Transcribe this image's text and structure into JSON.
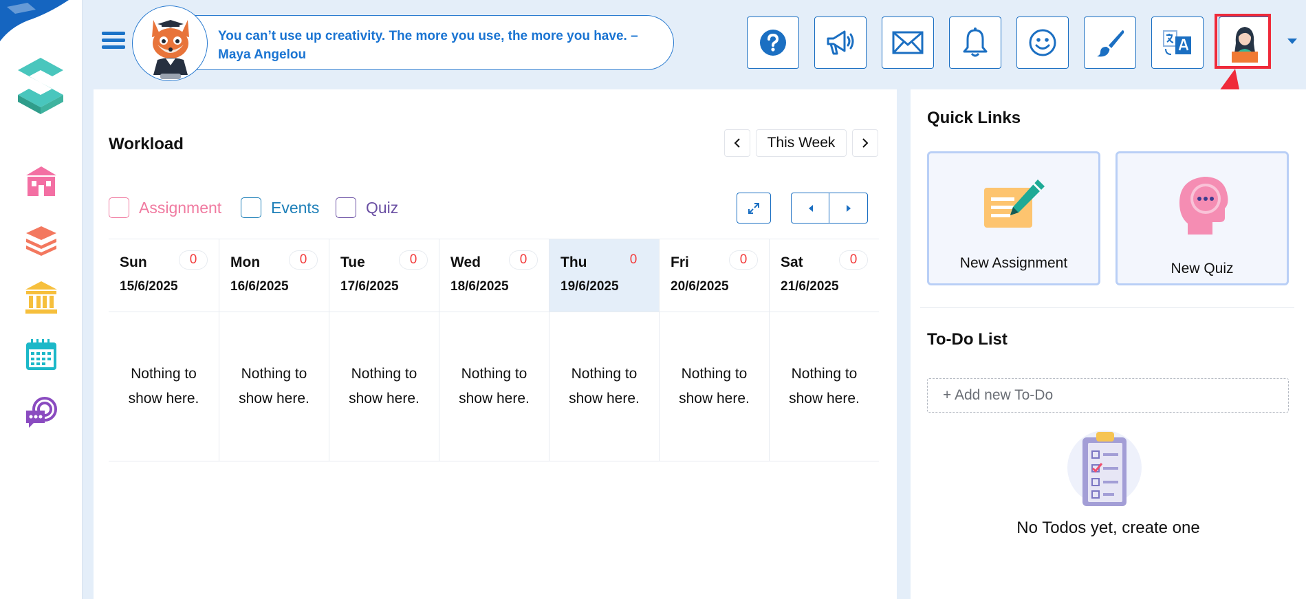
{
  "header": {
    "quote": "You can’t use up creativity. The more you use, the more you have. – Maya Angelou",
    "buttons": [
      "help-icon",
      "megaphone-icon",
      "mail-icon",
      "bell-icon",
      "smiley-icon",
      "paintbrush-icon",
      "translate-icon",
      "profile-avatar-icon"
    ]
  },
  "sidebar": {
    "items": [
      "school-icon",
      "books-icon",
      "institution-icon",
      "calendar-icon",
      "chat-icon"
    ]
  },
  "workload": {
    "title": "Workload",
    "range_label": "This Week",
    "legend": {
      "assignment": "Assignment",
      "events": "Events",
      "quiz": "Quiz"
    },
    "days": [
      {
        "name": "Sun",
        "date": "15/6/2025",
        "count": "0",
        "empty": "Nothing to show here."
      },
      {
        "name": "Mon",
        "date": "16/6/2025",
        "count": "0",
        "empty": "Nothing to show here."
      },
      {
        "name": "Tue",
        "date": "17/6/2025",
        "count": "0",
        "empty": "Nothing to show here."
      },
      {
        "name": "Wed",
        "date": "18/6/2025",
        "count": "0",
        "empty": "Nothing to show here."
      },
      {
        "name": "Thu",
        "date": "19/6/2025",
        "count": "0",
        "empty": "Nothing to show here."
      },
      {
        "name": "Fri",
        "date": "20/6/2025",
        "count": "0",
        "empty": "Nothing to show here."
      },
      {
        "name": "Sat",
        "date": "21/6/2025",
        "count": "0",
        "empty": "Nothing to show here."
      }
    ]
  },
  "quick_links": {
    "title": "Quick Links",
    "new_assignment": "New Assignment",
    "new_quiz": "New Quiz"
  },
  "todo": {
    "title": "To-Do List",
    "placeholder": "+ Add new To-Do",
    "empty": "No Todos yet, create one"
  },
  "colors": {
    "primary": "#1b6fc2",
    "assignment": "#f07aa0",
    "events": "#1d7fb8",
    "quiz": "#6a4fa3",
    "highlight": "#ef2a3a"
  }
}
